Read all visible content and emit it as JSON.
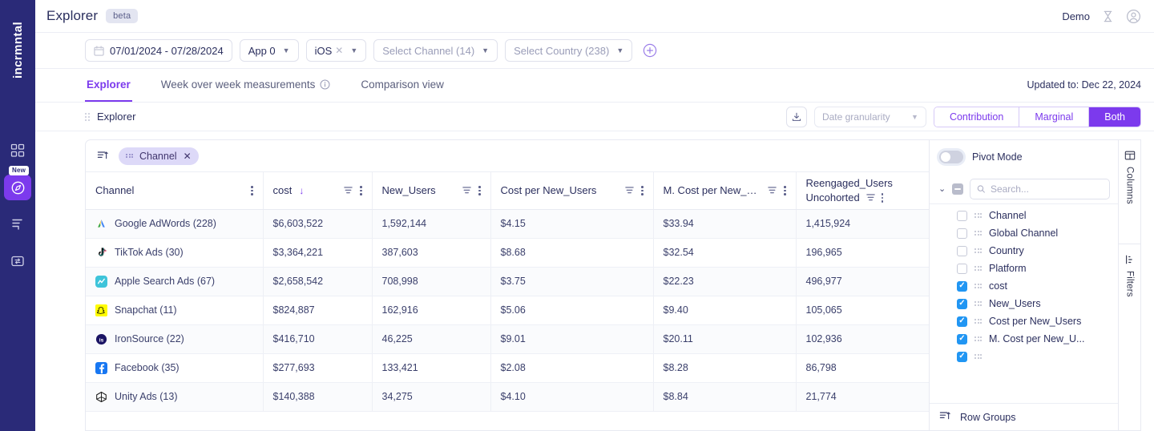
{
  "brand": {
    "logo_text": "incrmntal",
    "accent": "#7c3aed",
    "rail_bg": "#2a2a78"
  },
  "rail": {
    "items": [
      {
        "name": "dashboard-icon",
        "label": "Dashboard",
        "active": false,
        "badge": ""
      },
      {
        "name": "explorer-compass-icon",
        "label": "Explorer",
        "active": true,
        "badge": "New"
      },
      {
        "name": "reports-icon",
        "label": "Reports",
        "active": false,
        "badge": ""
      },
      {
        "name": "integrations-icon",
        "label": "Integrations",
        "active": false,
        "badge": ""
      }
    ]
  },
  "topbar": {
    "title": "Explorer",
    "beta_label": "beta",
    "account_label": "Demo",
    "hourglass_icon": "hourglass-icon",
    "avatar_icon": "user-avatar-icon"
  },
  "filters": {
    "date_range": "07/01/2024 - 07/28/2024",
    "app": "App 0",
    "platform": "iOS",
    "channel": "Select Channel (14)",
    "country": "Select Country (238)",
    "add_filter_icon": "add-circle-icon"
  },
  "tabs": [
    {
      "label": "Explorer",
      "active": true,
      "info": false
    },
    {
      "label": "Week over week measurements",
      "active": false,
      "info": true
    },
    {
      "label": "Comparison view",
      "active": false,
      "info": false
    }
  ],
  "updated": "Updated to: Dec 22, 2024",
  "cardbar": {
    "title": "Explorer",
    "download_icon": "download-icon",
    "granularity_placeholder": "Date granularity",
    "segments": [
      {
        "label": "Contribution",
        "active": false
      },
      {
        "label": "Marginal",
        "active": false
      },
      {
        "label": "Both",
        "active": true
      }
    ]
  },
  "grid": {
    "rowgroup_chip": "Channel",
    "columns": [
      {
        "label": "Channel",
        "sorted": false,
        "filter": false,
        "menu": true,
        "sublabel": ""
      },
      {
        "label": "cost",
        "sorted": true,
        "sort_dir": "↓",
        "filter": true,
        "menu": true,
        "sublabel": ""
      },
      {
        "label": "New_Users",
        "sorted": false,
        "filter": true,
        "menu": true,
        "sublabel": ""
      },
      {
        "label": "Cost per New_Users",
        "sorted": false,
        "filter": true,
        "menu": true,
        "sublabel": ""
      },
      {
        "label": "M. Cost per New_Users",
        "sorted": false,
        "filter": true,
        "menu": true,
        "sublabel": ""
      },
      {
        "label": "Reengaged_Users",
        "sorted": false,
        "filter": true,
        "menu": true,
        "sublabel": "Uncohorted"
      }
    ],
    "rows": [
      {
        "icon": "google-adwords-icon",
        "channel": "Google AdWords (228)",
        "cost": "$6,603,522",
        "new_users": "1,592,144",
        "cost_per_new_users": "$4.15",
        "m_cost_per_new_users": "$33.94",
        "reengaged_users": "1,415,924"
      },
      {
        "icon": "tiktok-ads-icon",
        "channel": "TikTok Ads (30)",
        "cost": "$3,364,221",
        "new_users": "387,603",
        "cost_per_new_users": "$8.68",
        "m_cost_per_new_users": "$32.54",
        "reengaged_users": "196,965"
      },
      {
        "icon": "apple-search-ads-icon",
        "channel": "Apple Search Ads (67)",
        "cost": "$2,658,542",
        "new_users": "708,998",
        "cost_per_new_users": "$3.75",
        "m_cost_per_new_users": "$22.23",
        "reengaged_users": "496,977"
      },
      {
        "icon": "snapchat-icon",
        "channel": "Snapchat (11)",
        "cost": "$824,887",
        "new_users": "162,916",
        "cost_per_new_users": "$5.06",
        "m_cost_per_new_users": "$9.40",
        "reengaged_users": "105,065"
      },
      {
        "icon": "ironsource-icon",
        "channel": "IronSource (22)",
        "cost": "$416,710",
        "new_users": "46,225",
        "cost_per_new_users": "$9.01",
        "m_cost_per_new_users": "$20.11",
        "reengaged_users": "102,936"
      },
      {
        "icon": "facebook-icon",
        "channel": "Facebook (35)",
        "cost": "$277,693",
        "new_users": "133,421",
        "cost_per_new_users": "$2.08",
        "m_cost_per_new_users": "$8.28",
        "reengaged_users": "86,798"
      },
      {
        "icon": "unity-ads-icon",
        "channel": "Unity Ads (13)",
        "cost": "$140,388",
        "new_users": "34,275",
        "cost_per_new_users": "$4.10",
        "m_cost_per_new_users": "$8.84",
        "reengaged_users": "21,774"
      }
    ]
  },
  "rightpanel": {
    "pivot_label": "Pivot Mode",
    "pivot_on": false,
    "search_placeholder": "Search...",
    "search_value": "",
    "columns": [
      {
        "label": "Channel",
        "checked": false
      },
      {
        "label": "Global Channel",
        "checked": false
      },
      {
        "label": "Country",
        "checked": false
      },
      {
        "label": "Platform",
        "checked": false
      },
      {
        "label": "cost",
        "checked": true
      },
      {
        "label": "New_Users",
        "checked": true
      },
      {
        "label": "Cost per New_Users",
        "checked": true
      },
      {
        "label": "M. Cost per New_U...",
        "checked": true
      }
    ],
    "row_groups_label": "Row Groups"
  },
  "vtabs": [
    {
      "label": "Columns",
      "icon": "columns-icon"
    },
    {
      "label": "Filters",
      "icon": "filters-icon"
    }
  ]
}
